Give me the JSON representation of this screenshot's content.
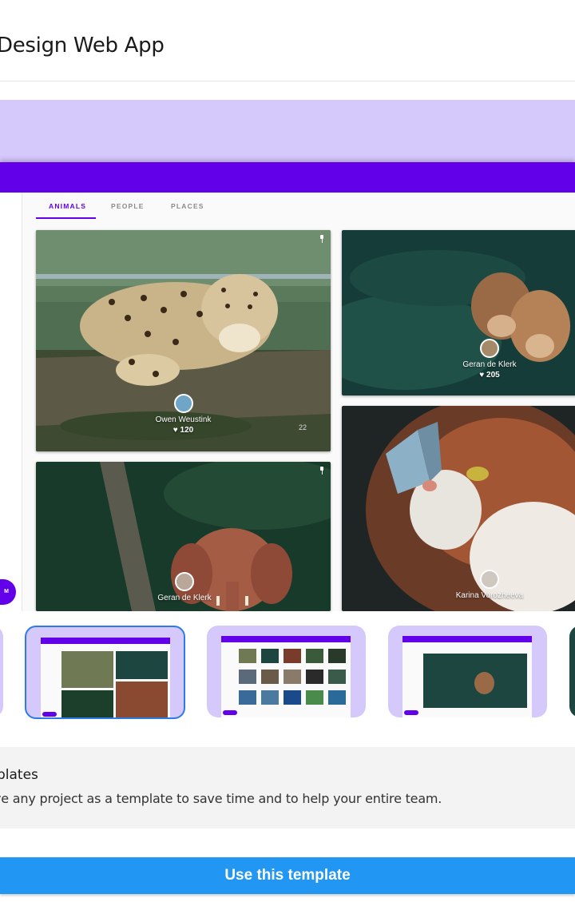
{
  "header": {
    "title": "Design Web App"
  },
  "preview": {
    "tabs": [
      {
        "label": "ANIMALS",
        "active": true
      },
      {
        "label": "PEOPLE",
        "active": false
      },
      {
        "label": "PLACES",
        "active": false
      }
    ],
    "fab_label": "M",
    "cards": [
      {
        "subject": "leopard",
        "author": "Owen Weustink",
        "likes": "♥ 120",
        "extra": "22"
      },
      {
        "subject": "lions",
        "author": "Geran de Klerk",
        "likes": "♥ 205"
      },
      {
        "subject": "elephant",
        "author": "Geran de Klerk",
        "likes": ""
      },
      {
        "subject": "cat with butterfly",
        "author": "Karina Vorozheeva",
        "likes": ""
      }
    ]
  },
  "thumbnails": {
    "items": [
      {
        "name": "partial-left",
        "selected": false
      },
      {
        "name": "animals-masonry",
        "selected": true
      },
      {
        "name": "grid-gallery",
        "selected": false
      },
      {
        "name": "detail-view",
        "selected": false
      },
      {
        "name": "partial-right",
        "selected": false
      }
    ]
  },
  "info": {
    "title": "plates",
    "description": "ve any project as a template to save time and to help your entire team."
  },
  "cta": {
    "label": "Use this template"
  },
  "colors": {
    "accent": "#6200ea",
    "lavender": "#d5c8fb",
    "cta": "#2196f3"
  }
}
